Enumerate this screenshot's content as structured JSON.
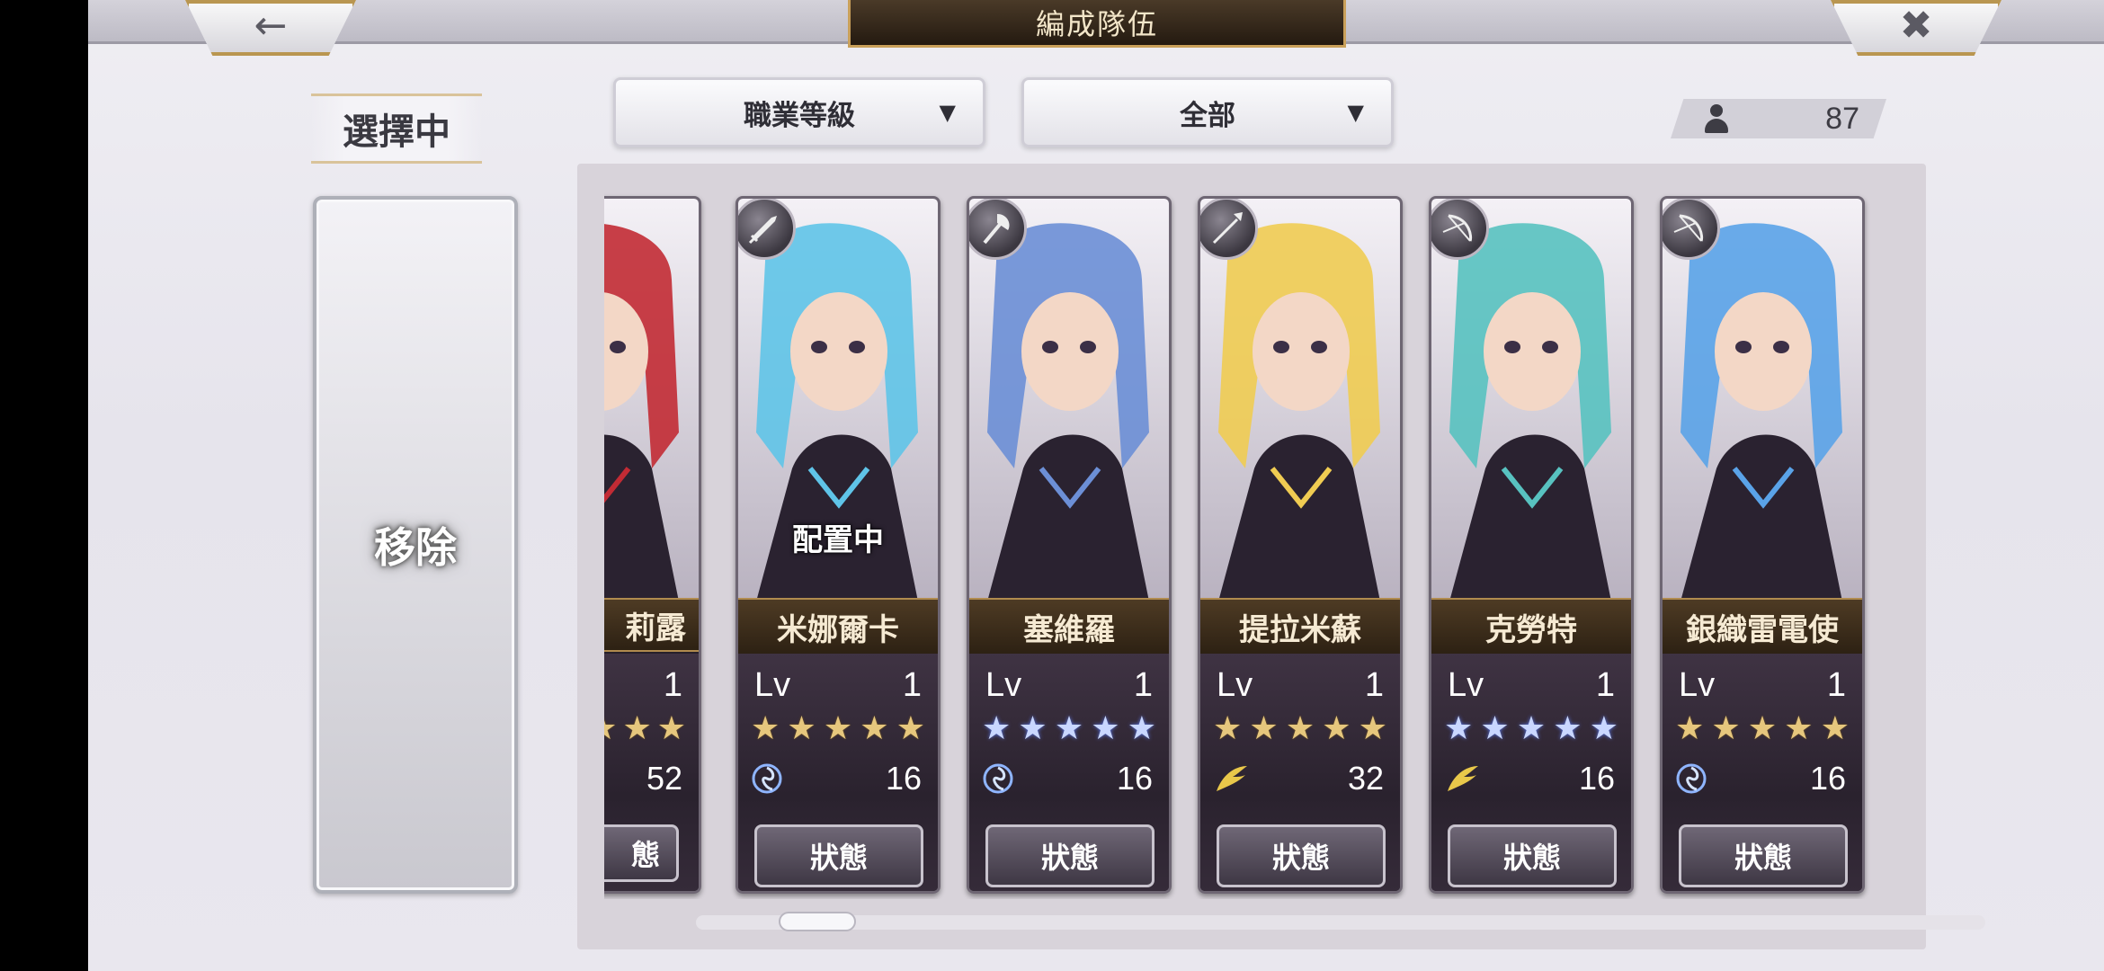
{
  "header": {
    "back_icon": "arrow-left-icon",
    "close_icon": "close-icon",
    "title": "編成隊伍"
  },
  "filters": {
    "sort": {
      "label": "職業等級",
      "icon": "caret-down-icon"
    },
    "category": {
      "label": "全部",
      "icon": "caret-down-icon"
    }
  },
  "unit_count": {
    "icon": "person-icon",
    "value": "87"
  },
  "selection": {
    "label": "選擇中",
    "remove_label": "移除"
  },
  "cards": [
    {
      "name": "莉露",
      "partial": true,
      "lv_label": "",
      "level": "1",
      "rarity": 3,
      "star_color": "gold",
      "cost": "52",
      "cost_icon": "",
      "status_label": "態",
      "class_icon": "",
      "deployed": "",
      "accent": "#c22b34"
    },
    {
      "name": "米娜爾卡",
      "lv_label": "Lv",
      "level": "1",
      "rarity": 5,
      "star_color": "gold",
      "cost": "16",
      "cost_icon": "swirl-icon",
      "status_label": "狀態",
      "class_icon": "sword-icon",
      "deployed": "配置中",
      "accent": "#5fc4e8"
    },
    {
      "name": "塞維羅",
      "lv_label": "Lv",
      "level": "1",
      "rarity": 5,
      "star_color": "blue",
      "cost": "16",
      "cost_icon": "swirl-icon",
      "status_label": "狀態",
      "class_icon": "axe-icon",
      "deployed": "",
      "accent": "#6c8fd6"
    },
    {
      "name": "提拉米蘇",
      "lv_label": "Lv",
      "level": "1",
      "rarity": 5,
      "star_color": "gold",
      "cost": "32",
      "cost_icon": "wing-icon",
      "status_label": "狀態",
      "class_icon": "spear-icon",
      "deployed": "",
      "accent": "#f0cc52"
    },
    {
      "name": "克勞特",
      "lv_label": "Lv",
      "level": "1",
      "rarity": 5,
      "star_color": "blue",
      "cost": "16",
      "cost_icon": "wing-icon",
      "status_label": "狀態",
      "class_icon": "bow-icon",
      "deployed": "",
      "accent": "#58c2c0"
    },
    {
      "name": "銀織雷電使",
      "lv_label": "Lv",
      "level": "1",
      "rarity": 5,
      "star_color": "gold",
      "cost": "16",
      "cost_icon": "swirl-icon",
      "status_label": "狀態",
      "class_icon": "bow-icon",
      "deployed": "",
      "accent": "#5aa3e8"
    }
  ],
  "scroll": {
    "position": 0.04
  }
}
